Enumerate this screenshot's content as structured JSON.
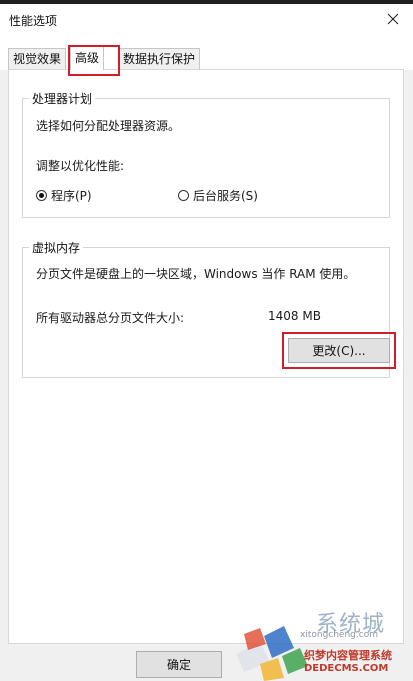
{
  "window": {
    "title": "性能选项"
  },
  "tabs": [
    {
      "label": "视觉效果",
      "active": false
    },
    {
      "label": "高级",
      "active": true
    },
    {
      "label": "数据执行保护",
      "active": false
    }
  ],
  "processor_scheduling": {
    "legend": "处理器计划",
    "description": "选择如何分配处理器资源。",
    "adjust_label": "调整以优化性能:",
    "options": [
      {
        "label": "程序(P)",
        "selected": true
      },
      {
        "label": "后台服务(S)",
        "selected": false
      }
    ]
  },
  "virtual_memory": {
    "legend": "虚拟内存",
    "description": "分页文件是硬盘上的一块区域，Windows 当作 RAM 使用。",
    "total_label": "所有驱动器总分页文件大小:",
    "total_value": "1408 MB",
    "change_button": "更改(C)..."
  },
  "footer": {
    "ok_button": "确定"
  },
  "watermark": {
    "brand_cn": "系统城",
    "brand_latin": "xitongcheng.com",
    "line1": "织梦内容管理系统",
    "line2": "DEDECMS.COM"
  },
  "colors": {
    "highlight": "#d21c2a",
    "window_bg": "#f0f0f0",
    "panel_bg": "#ffffff"
  }
}
